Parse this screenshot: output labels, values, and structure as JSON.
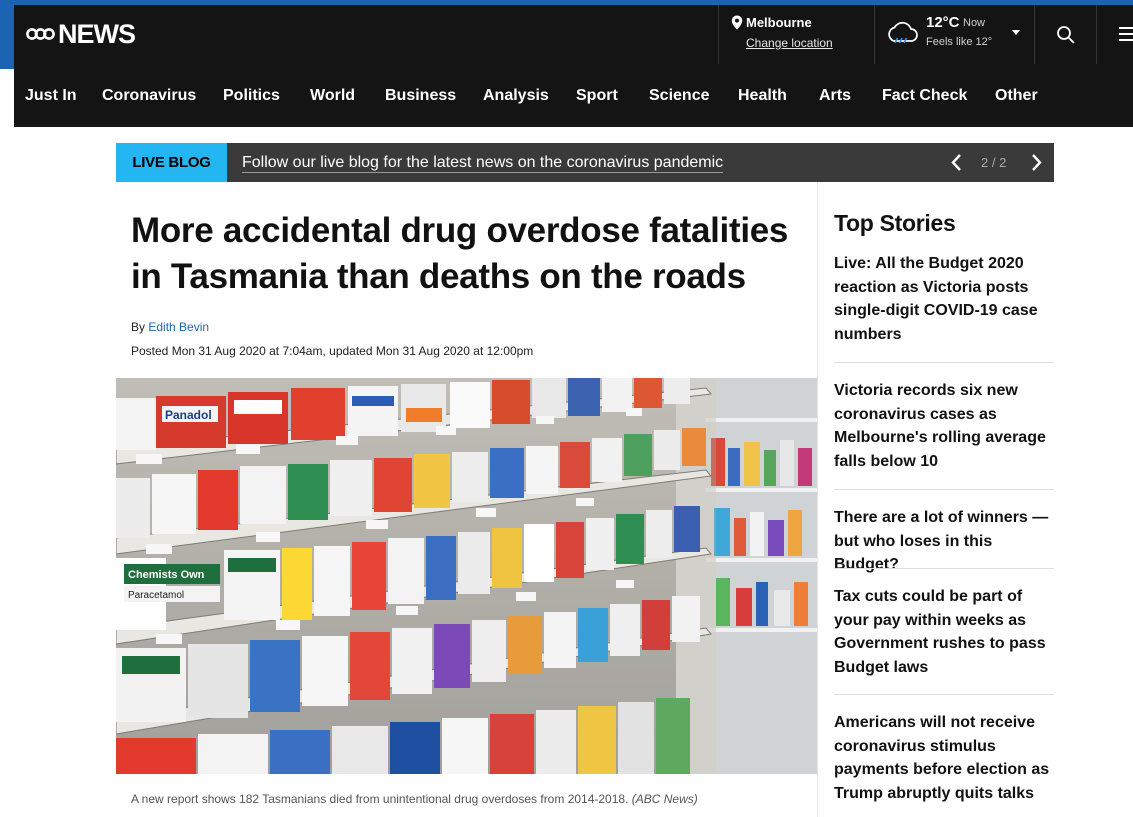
{
  "header": {
    "logo_text": "NEWS",
    "location": {
      "city": "Melbourne",
      "change_label": "Change location"
    },
    "weather": {
      "temp": "12°C",
      "now_label": "Now",
      "feels_like": "Feels like 12°"
    }
  },
  "nav": {
    "items": [
      "Just In",
      "Coronavirus",
      "Politics",
      "World",
      "Business",
      "Analysis",
      "Sport",
      "Science",
      "Health",
      "Arts",
      "Fact Check",
      "Other"
    ]
  },
  "live_blog": {
    "badge": "LIVE BLOG",
    "text": "Follow our live blog for the latest news on the coronavirus pandemic",
    "counter": "2 / 2"
  },
  "article": {
    "headline": "More accidental drug overdose fatalities in Tasmania than deaths on the roads",
    "by_label": "By",
    "author": "Edith Bevin",
    "posted": "Posted Mon 31 Aug 2020 at 7:04am, updated Mon 31 Aug 2020 at 12:00pm",
    "caption": "A new report shows 182 Tasmanians died from unintentional drug overdoses from 2014-2018.",
    "credit": "(ABC News)",
    "image_text": {
      "panadol": "Panadol",
      "chemists_own": "Chemists Own",
      "paracetamol": "Paracetamol"
    }
  },
  "top_stories": {
    "title": "Top Stories",
    "items": [
      "Live: All the Budget 2020 reaction as Victoria posts single-digit COVID-19 case numbers",
      "Victoria records six new coronavirus cases as Melbourne's rolling average falls below 10",
      "There are a lot of winners — but who loses in this Budget?",
      "Tax cuts could be part of your pay within weeks as Government rushes to pass Budget laws",
      "Americans will not receive coronavirus stimulus payments before election as Trump abruptly quits talks"
    ]
  },
  "colors": {
    "brand_blue": "#1b64b3",
    "live_badge": "#23b6f2",
    "header_bg": "#141414",
    "live_bar_bg": "#3a3a3a"
  }
}
